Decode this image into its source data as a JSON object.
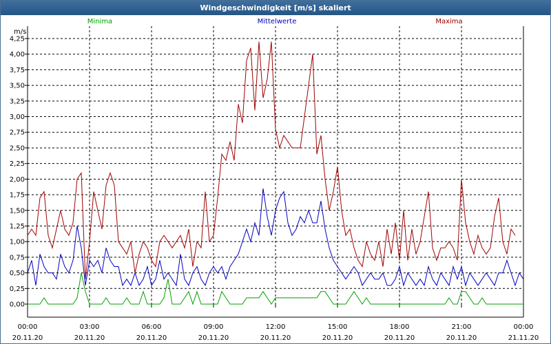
{
  "window": {
    "title": "Windgeschwindigkeit [m/s] skaliert"
  },
  "colors": {
    "min": "#00a000",
    "mean": "#0000c0",
    "max": "#a00000",
    "titlebar": "#2f6393"
  },
  "chart_data": {
    "type": "line",
    "title": "Windgeschwindigkeit [m/s] skaliert",
    "ylabel": "m/s",
    "ylim": [
      0,
      4.25
    ],
    "xlim_hours": [
      0,
      24
    ],
    "grid": true,
    "legend_placement": "top",
    "y_ticks": [
      "0,00",
      "0,25",
      "0,50",
      "0,75",
      "1,00",
      "1,25",
      "1,50",
      "1,75",
      "2,00",
      "2,25",
      "2,50",
      "2,75",
      "3,00",
      "3,25",
      "3,50",
      "3,75",
      "4,00",
      "4,25"
    ],
    "x_ticks": [
      {
        "time": "00:00",
        "date": "20.11.20"
      },
      {
        "time": "03:00",
        "date": "20.11.20"
      },
      {
        "time": "06:00",
        "date": "20.11.20"
      },
      {
        "time": "09:00",
        "date": "20.11.20"
      },
      {
        "time": "12:00",
        "date": "20.11.20"
      },
      {
        "time": "15:00",
        "date": "20.11.20"
      },
      {
        "time": "18:00",
        "date": "20.11.20"
      },
      {
        "time": "21:00",
        "date": "20.11.20"
      },
      {
        "time": "00:00",
        "date": "21.11.20"
      }
    ],
    "x_hours": [
      0,
      0.2,
      0.4,
      0.6,
      0.8,
      1,
      1.2,
      1.4,
      1.6,
      1.8,
      2,
      2.2,
      2.4,
      2.6,
      2.8,
      3,
      3.2,
      3.4,
      3.6,
      3.8,
      4,
      4.2,
      4.4,
      4.6,
      4.8,
      5,
      5.2,
      5.4,
      5.6,
      5.8,
      6,
      6.2,
      6.4,
      6.6,
      6.8,
      7,
      7.2,
      7.4,
      7.6,
      7.8,
      8,
      8.2,
      8.4,
      8.6,
      8.8,
      9,
      9.2,
      9.4,
      9.6,
      9.8,
      10,
      10.2,
      10.4,
      10.6,
      10.8,
      11,
      11.2,
      11.4,
      11.6,
      11.8,
      12,
      12.2,
      12.4,
      12.6,
      12.8,
      13,
      13.2,
      13.4,
      13.6,
      13.8,
      14,
      14.2,
      14.4,
      14.6,
      14.8,
      15,
      15.2,
      15.4,
      15.6,
      15.8,
      16,
      16.2,
      16.4,
      16.6,
      16.8,
      17,
      17.2,
      17.4,
      17.6,
      17.8,
      18,
      18.2,
      18.4,
      18.6,
      18.8,
      19,
      19.2,
      19.4,
      19.6,
      19.8,
      20,
      20.2,
      20.4,
      20.6,
      20.8,
      21,
      21.2,
      21.4,
      21.6,
      21.8,
      22,
      22.2,
      22.4,
      22.6,
      22.8,
      23,
      23.2,
      23.4,
      23.6,
      23.8,
      24
    ],
    "series": [
      {
        "name": "Minima",
        "values": [
          0,
          0,
          0,
          0,
          0.1,
          0,
          0,
          0,
          0,
          0,
          0,
          0,
          0.1,
          0.5,
          0.2,
          0,
          0,
          0,
          0,
          0.1,
          0,
          0,
          0,
          0,
          0.1,
          0,
          0,
          0,
          0.2,
          0,
          0,
          0,
          0,
          0.1,
          0.4,
          0,
          0,
          0,
          0.1,
          0.2,
          0,
          0.2,
          0,
          0,
          0,
          0,
          0,
          0.2,
          0.1,
          0,
          0,
          0,
          0,
          0.1,
          0.1,
          0.1,
          0.1,
          0.2,
          0.1,
          0,
          0.1,
          0.1,
          0.1,
          0.1,
          0.1,
          0.1,
          0.1,
          0.1,
          0.1,
          0.1,
          0.1,
          0.2,
          0.2,
          0.1,
          0,
          0,
          0,
          0,
          0.1,
          0.2,
          0.1,
          0,
          0.1,
          0,
          0,
          0,
          0,
          0,
          0,
          0,
          0,
          0,
          0,
          0,
          0,
          0,
          0,
          0,
          0,
          0,
          0,
          0,
          0.1,
          0,
          0,
          0.2,
          0.2,
          0.1,
          0,
          0,
          0.1,
          0,
          0,
          0,
          0,
          0,
          0,
          0,
          0,
          0,
          0
        ]
      },
      {
        "name": "Mittelwerte",
        "values": [
          0.5,
          0.7,
          0.3,
          0.8,
          0.6,
          0.5,
          0.5,
          0.4,
          0.8,
          0.6,
          0.5,
          0.7,
          1.25,
          0.9,
          0.3,
          0.7,
          0.6,
          0.7,
          0.5,
          0.9,
          0.7,
          0.6,
          0.6,
          0.3,
          0.4,
          0.3,
          0.5,
          0.3,
          0.4,
          0.6,
          0.3,
          0.4,
          0.7,
          0.4,
          0.5,
          0.4,
          0.3,
          0.8,
          0.4,
          0.3,
          0.5,
          0.6,
          0.4,
          0.3,
          0.5,
          0.6,
          0.5,
          0.6,
          0.4,
          0.6,
          0.7,
          0.8,
          1.0,
          1.2,
          1.0,
          1.3,
          1.1,
          1.85,
          1.4,
          1.1,
          1.5,
          1.7,
          1.8,
          1.3,
          1.1,
          1.2,
          1.4,
          1.3,
          1.5,
          1.3,
          1.3,
          1.65,
          1.2,
          0.9,
          0.7,
          0.6,
          0.5,
          0.4,
          0.5,
          0.6,
          0.5,
          0.3,
          0.4,
          0.5,
          0.4,
          0.4,
          0.5,
          0.3,
          0.3,
          0.4,
          0.6,
          0.3,
          0.5,
          0.4,
          0.3,
          0.4,
          0.3,
          0.6,
          0.4,
          0.3,
          0.5,
          0.4,
          0.3,
          0.6,
          0.4,
          0.6,
          0.3,
          0.5,
          0.4,
          0.3,
          0.4,
          0.5,
          0.4,
          0.3,
          0.5,
          0.5,
          0.7,
          0.5,
          0.3,
          0.5,
          0.4
        ]
      },
      {
        "name": "Maxima",
        "values": [
          1.1,
          1.2,
          1.1,
          1.7,
          1.8,
          1.1,
          0.9,
          1.2,
          1.5,
          1.2,
          1.1,
          1.3,
          2.0,
          2.1,
          0.4,
          1.0,
          1.8,
          1.5,
          1.2,
          1.9,
          2.1,
          1.9,
          1.0,
          0.9,
          0.8,
          1.0,
          0.5,
          0.8,
          1.0,
          0.9,
          0.7,
          0.6,
          1.0,
          1.1,
          1.0,
          0.9,
          1.0,
          1.1,
          0.9,
          1.2,
          0.6,
          1.0,
          0.9,
          1.8,
          1.0,
          1.1,
          1.7,
          2.4,
          2.3,
          2.6,
          2.3,
          3.2,
          2.9,
          3.9,
          4.1,
          3.1,
          4.2,
          3.3,
          3.6,
          4.2,
          2.8,
          2.5,
          2.7,
          2.6,
          2.5,
          2.5,
          2.5,
          3.0,
          3.5,
          4.0,
          2.4,
          2.7,
          2.0,
          1.5,
          1.8,
          2.2,
          1.5,
          1.1,
          1.2,
          0.9,
          0.7,
          0.6,
          1.0,
          0.8,
          0.7,
          1.0,
          0.6,
          1.2,
          0.8,
          1.3,
          0.7,
          1.5,
          0.7,
          1.2,
          0.8,
          1.0,
          1.4,
          1.8,
          0.9,
          0.7,
          0.9,
          0.9,
          1.0,
          0.9,
          0.7,
          2.0,
          1.3,
          1.0,
          0.8,
          1.1,
          0.9,
          0.8,
          0.9,
          1.4,
          1.7,
          1.0,
          0.8,
          1.2,
          1.1
        ]
      }
    ]
  }
}
